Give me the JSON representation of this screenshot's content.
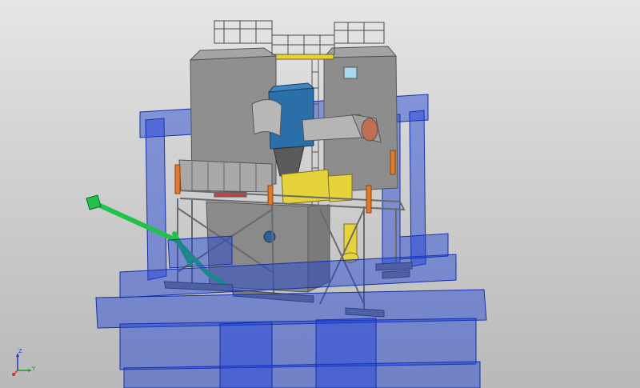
{
  "viewport": {
    "background_top": "#e6e6e6",
    "background_bottom": "#b9b9b9"
  },
  "model": {
    "foundation_color": "#1a3fd8",
    "steel_color": "#8c8c8c",
    "housing_color": "#8f8f8f",
    "duct_color": "#4aa0c8",
    "blue_unit_color": "#2a6fa8",
    "green_pipe_color": "#22c24a",
    "orange_column_color": "#e07a2a",
    "yellow_part_color": "#e6d23a"
  },
  "axis_triad": {
    "z_label": "Z",
    "y_label": "Y",
    "x_color": "#d23030",
    "y_color": "#1f9a2a",
    "z_color": "#2a35c8"
  }
}
